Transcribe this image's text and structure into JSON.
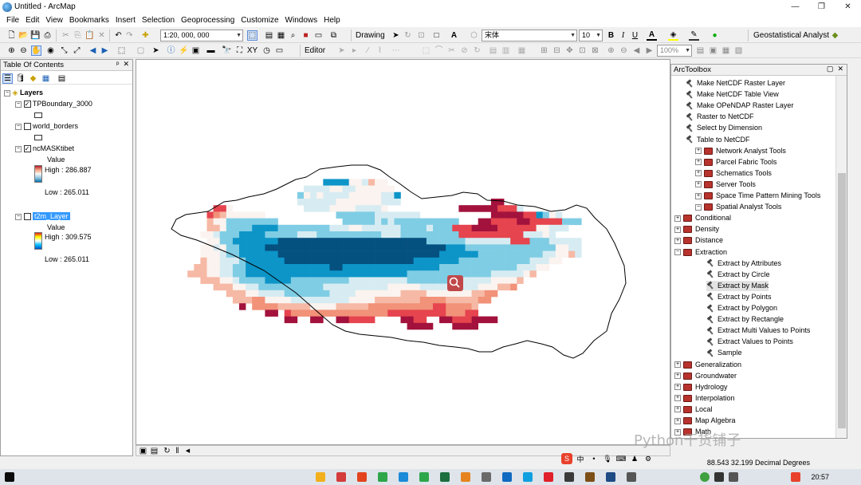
{
  "window": {
    "title": "Untitled - ArcMap",
    "minimize": "—",
    "maximize": "❐",
    "close": "✕"
  },
  "menu": [
    "File",
    "Edit",
    "View",
    "Bookmarks",
    "Insert",
    "Selection",
    "Geoprocessing",
    "Customize",
    "Windows",
    "Help"
  ],
  "toolbar": {
    "scale": "1:20, 000, 000",
    "drawing_label": "Drawing",
    "font_name": "宋体",
    "font_size": "10",
    "bold": "B",
    "italic": "I",
    "underline": "U",
    "text_tool": "A",
    "geostat_label": "Geostatistical Analyst",
    "editor_label": "Editor",
    "zoom_percent": "100%"
  },
  "toc": {
    "header": "Table Of Contents",
    "pin": "ᵖ",
    "close": "✕",
    "root": "Layers",
    "layers": [
      {
        "name": "TPBoundary_3000",
        "checked": true
      },
      {
        "name": "world_borders",
        "checked": false
      },
      {
        "name": "ncMASKtibet",
        "checked": true,
        "field": "Value",
        "high": "High : 286.887",
        "low": "Low : 265.011"
      },
      {
        "name": "t2m_Layer",
        "checked": false,
        "field": "Value",
        "high": "High : 309.575",
        "low": "Low : 265.011"
      }
    ]
  },
  "arctoolbox": {
    "header": "ArcToolbox",
    "items": [
      {
        "label": "Make NetCDF Raster Layer",
        "kind": "tool",
        "level": 2
      },
      {
        "label": "Make NetCDF Table View",
        "kind": "tool",
        "level": 2
      },
      {
        "label": "Make OPeNDAP Raster Layer",
        "kind": "tool",
        "level": 2
      },
      {
        "label": "Raster to NetCDF",
        "kind": "tool",
        "level": 2
      },
      {
        "label": "Select by Dimension",
        "kind": "tool",
        "level": 2
      },
      {
        "label": "Table to NetCDF",
        "kind": "tool",
        "level": 2
      },
      {
        "label": "Network Analyst Tools",
        "kind": "box",
        "level": 0,
        "exp": "+"
      },
      {
        "label": "Parcel Fabric Tools",
        "kind": "box",
        "level": 0,
        "exp": "+"
      },
      {
        "label": "Schematics Tools",
        "kind": "box",
        "level": 0,
        "exp": "+"
      },
      {
        "label": "Server Tools",
        "kind": "box",
        "level": 0,
        "exp": "+"
      },
      {
        "label": "Space Time Pattern Mining Tools",
        "kind": "box",
        "level": 0,
        "exp": "+"
      },
      {
        "label": "Spatial Analyst Tools",
        "kind": "box",
        "level": 0,
        "exp": "−"
      },
      {
        "label": "Conditional",
        "kind": "box",
        "level": 1,
        "exp": "+"
      },
      {
        "label": "Density",
        "kind": "box",
        "level": 1,
        "exp": "+"
      },
      {
        "label": "Distance",
        "kind": "box",
        "level": 1,
        "exp": "+"
      },
      {
        "label": "Extraction",
        "kind": "box",
        "level": 1,
        "exp": "−"
      },
      {
        "label": "Extract by Attributes",
        "kind": "tool",
        "level": 3
      },
      {
        "label": "Extract by Circle",
        "kind": "tool",
        "level": 3
      },
      {
        "label": "Extract by Mask",
        "kind": "tool",
        "level": 3,
        "highlight": true
      },
      {
        "label": "Extract by Points",
        "kind": "tool",
        "level": 3
      },
      {
        "label": "Extract by Polygon",
        "kind": "tool",
        "level": 3
      },
      {
        "label": "Extract by Rectangle",
        "kind": "tool",
        "level": 3
      },
      {
        "label": "Extract Multi Values to Points",
        "kind": "tool",
        "level": 3
      },
      {
        "label": "Extract Values to Points",
        "kind": "tool",
        "level": 3
      },
      {
        "label": "Sample",
        "kind": "tool",
        "level": 3
      },
      {
        "label": "Generalization",
        "kind": "box",
        "level": 1,
        "exp": "+"
      },
      {
        "label": "Groundwater",
        "kind": "box",
        "level": 1,
        "exp": "+"
      },
      {
        "label": "Hydrology",
        "kind": "box",
        "level": 1,
        "exp": "+"
      },
      {
        "label": "Interpolation",
        "kind": "box",
        "level": 1,
        "exp": "+"
      },
      {
        "label": "Local",
        "kind": "box",
        "level": 1,
        "exp": "+"
      },
      {
        "label": "Map Algebra",
        "kind": "box",
        "level": 1,
        "exp": "+"
      },
      {
        "label": "Math",
        "kind": "box",
        "level": 1,
        "exp": "+"
      }
    ]
  },
  "status": {
    "coords": "88.543  32.199 Decimal Degrees"
  },
  "watermark": "Python干货铺子",
  "taskbar": {
    "clock": "20:57"
  },
  "colors": {
    "dark_blue": "#04507f",
    "blue": "#0d95c8",
    "light_blue": "#7fcde4",
    "pale": "#d7ecf2",
    "white": "#fbf3ef",
    "salmon": "#f6b9a5",
    "red": "#e6444e",
    "dark_red": "#a3123c",
    "select": "#3399ff"
  },
  "raster": {
    "cols": 76,
    "rows": 38,
    "codes": [
      "............................................................................",
      "............................................................................",
      ".......................1111443544...........................................",
      "....................33334433444444..........................................",
      "...................2434333344444331.........................................",
      "...................3333334444444333..............88........................",
      "......774...........3333444433334...........8888887773...............",
      ".....765444444...........2222223333333...........88888771243.........",
      ".....54422222222..........222223232222222222...8877778877777222.......",
      ".....55422221111222222223334433333322223222777888877777744333.........",
      "....4432221111222223332222222222333222222222777777777733343...........",
      ".....4422111111100000000000000000000000222222333333377722233333.......",
      "....44342211110000000000000000000000000000111222222222222224433.......",
      "....44432211111100000000000000000000000001111112222222222334453.......",
      "....54433321111110000000000000000000011111112222222222233344.........",
      "...5544332211111111111110011111111111111122222222222233344............",
      "..555443322111111111111111111111111122222222222223333345..............",
      "....55544322221111222222222333333333222222233333344445................",
      "......55544332222222222333333333344444333333333444556.................",
      "........555443333222222233334444444555544444445566....................",
      ".........5556644443333333334444555555566665555566.....................",
      "..........8.66665555544445555566666666667766665.......................",
      "..............88.766666666666666677777777766677.......................",
      ".................88..88..887777....8877..887778888....................",
      "....................................8888...8888.......................",
      "............................................................................"
    ]
  }
}
